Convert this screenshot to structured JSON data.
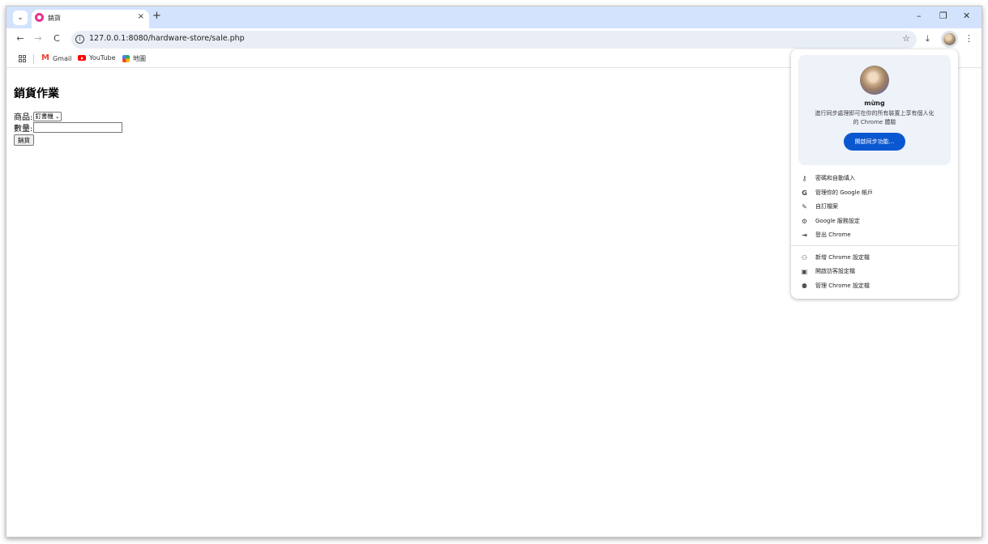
{
  "tabstrip": {
    "tab_title": "銷貨",
    "tab_close": "×",
    "new_tab": "+",
    "minimize": "–",
    "restore": "❐",
    "close": "✕"
  },
  "toolbar": {
    "back": "←",
    "forward": "→",
    "reload": "C",
    "url": "127.0.0.1:8080/hardware-store/sale.php",
    "star": "☆",
    "download": "⤓",
    "menu": "⋮"
  },
  "bookmarks": {
    "items": [
      {
        "label": "Gmail",
        "icon": "gmail-icon"
      },
      {
        "label": "YouTube",
        "icon": "youtube-icon"
      },
      {
        "label": "地圖",
        "icon": "maps-icon"
      }
    ]
  },
  "page": {
    "title": "銷貨作業",
    "product_label": "商品:",
    "product_selected": "釘書機",
    "quantity_label": "數量:",
    "quantity_value": "",
    "submit_label": "銷貨"
  },
  "profile_menu": {
    "name": "mừng",
    "desc_line1": "進行同步處理即可在你的所有裝置上享有個人化",
    "desc_line2": "的 Chrome 體驗",
    "sync_button": "開啟同步功能...",
    "items": [
      {
        "label": "密碼和自動填入",
        "icon": "key-icon"
      },
      {
        "label": "管理你的 Google 帳戶",
        "icon": "google-icon"
      },
      {
        "label": "自訂檔案",
        "icon": "pencil-icon"
      },
      {
        "label": "Google 服務設定",
        "icon": "gear-icon"
      },
      {
        "label": "登出 Chrome",
        "icon": "logout-icon"
      },
      {
        "label": "新增 Chrome 設定檔",
        "icon": "add-person-icon"
      },
      {
        "label": "開啟訪客設定檔",
        "icon": "guest-icon"
      },
      {
        "label": "管理 Chrome 設定檔",
        "icon": "manage-profiles-icon"
      }
    ]
  }
}
